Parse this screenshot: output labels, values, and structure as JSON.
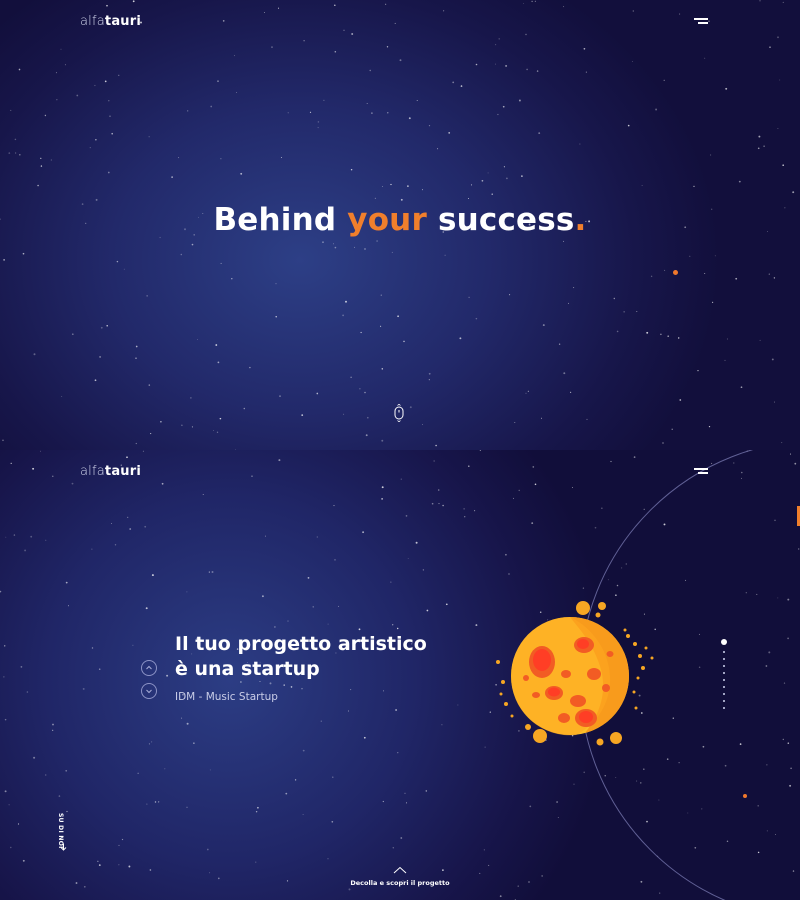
{
  "brand": {
    "logo_light": "alfa",
    "logo_bold": "tauri"
  },
  "hero": {
    "word1": "Behind ",
    "word2": "your",
    "word3": " success",
    "period": "."
  },
  "slide": {
    "title_line1": "Il tuo progetto artistico",
    "title_line2": "è una startup",
    "subtitle": "IDM - Music Startup"
  },
  "side_label": "SU DI NOI",
  "cta": "Decolla e scopri il progetto",
  "pager": {
    "count": 10,
    "active": 1
  },
  "icons": [
    "menu-icon",
    "scroll-mouse-icon",
    "chevron-up-icon",
    "chevron-down-icon",
    "arrow-down-icon",
    "planet-illustration"
  ],
  "colors": {
    "accent": "#f07f2c",
    "background": "#141245",
    "text": "#ffffff",
    "planet": "#f6a623"
  }
}
